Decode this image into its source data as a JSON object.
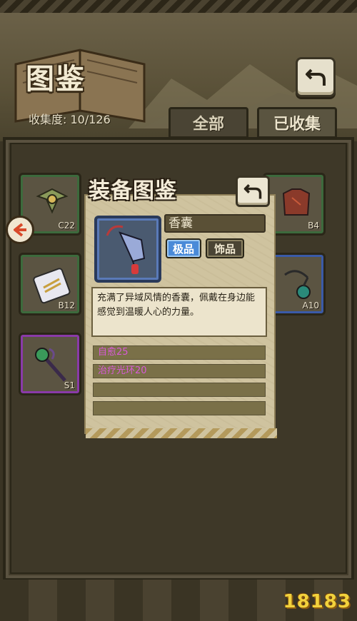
{
  "header": {
    "title": "图鉴",
    "collect_label": "收集度:",
    "collect_count": "10/126"
  },
  "tabs": [
    {
      "label": "全部"
    },
    {
      "label": "已收集"
    }
  ],
  "slots": [
    {
      "code": "C22",
      "frame": "green",
      "icon": "ornament-icon"
    },
    {
      "code": "B12",
      "frame": "green",
      "icon": "plate-icon"
    },
    {
      "code": "S1",
      "frame": "purple",
      "icon": "staff-icon"
    },
    {
      "code": "B4",
      "frame": "green",
      "icon": "armor-icon"
    },
    {
      "code": "A10",
      "frame": "blue",
      "icon": "amulet-icon"
    }
  ],
  "popup": {
    "title": "装备图鉴",
    "item_name": "香囊",
    "grade": "极品",
    "type": "饰品",
    "description": "充满了异域风情的香囊，佩戴在身边能感觉到温暖人心的力量。",
    "stats": [
      "自愈25",
      "治疗光环20",
      "",
      ""
    ]
  },
  "watermark": "18183",
  "colors": {
    "grade_blue": "#4a8ad8",
    "stat_pink": "#d85ad8",
    "logo_yellow": "#f2d23c"
  }
}
